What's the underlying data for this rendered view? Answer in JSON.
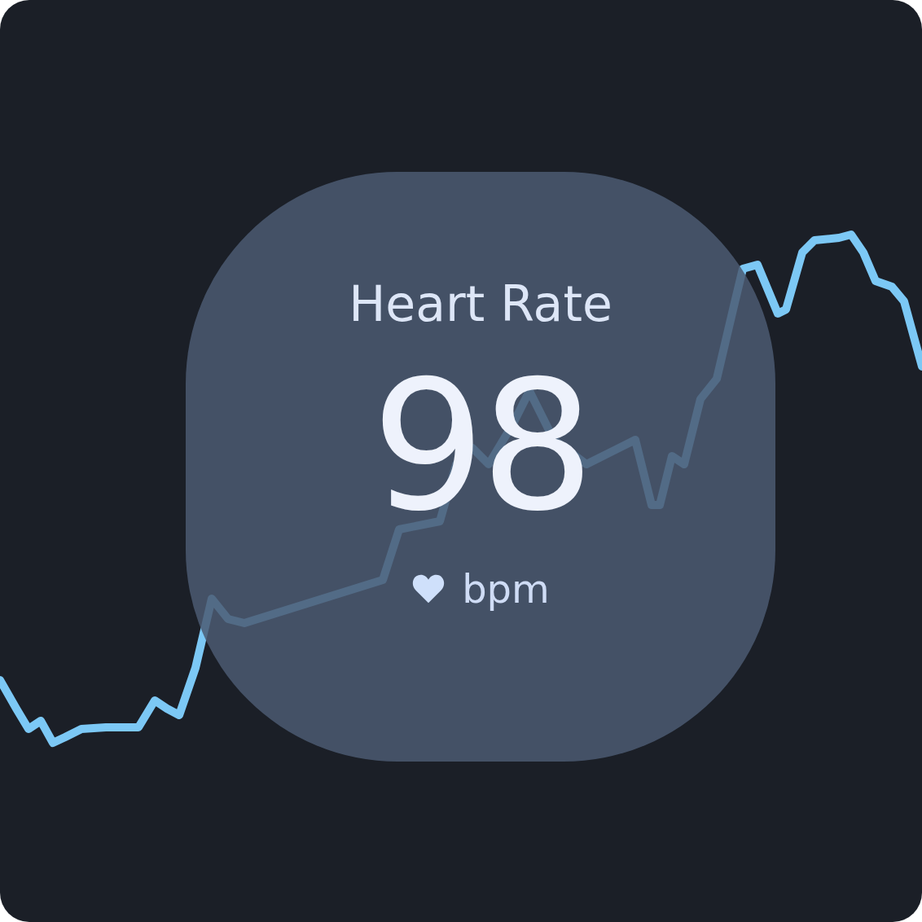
{
  "card": {
    "title": "Heart Rate",
    "value": "98",
    "unit": "bpm"
  }
}
